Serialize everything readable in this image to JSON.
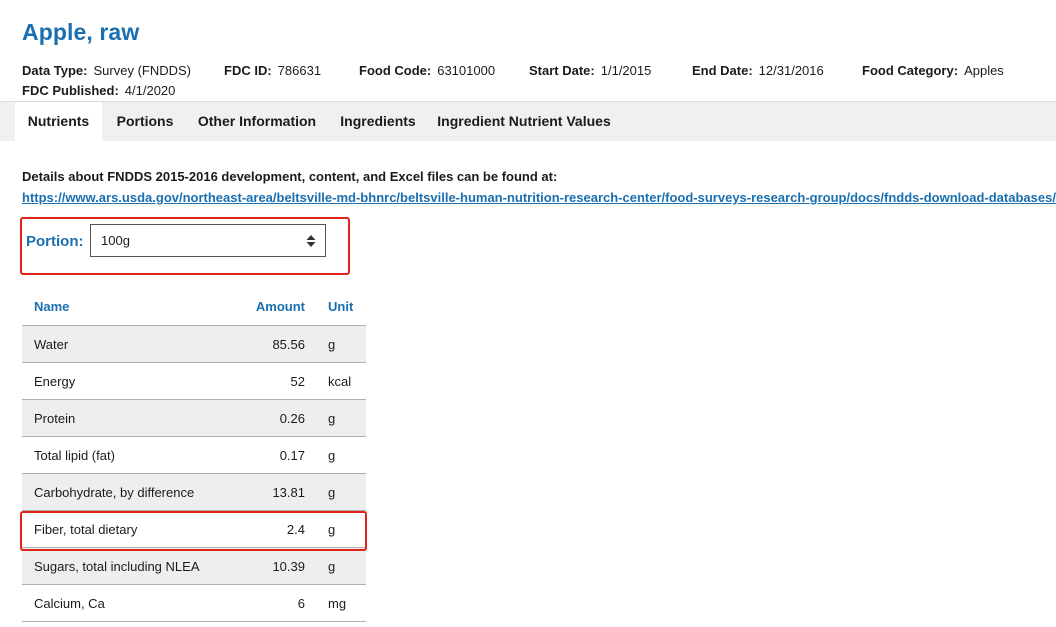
{
  "title": "Apple, raw",
  "meta": {
    "data_type": {
      "label": "Data Type:",
      "value": "Survey (FNDDS)"
    },
    "fdc_id": {
      "label": "FDC ID:",
      "value": "786631"
    },
    "food_code": {
      "label": "Food Code:",
      "value": "63101000"
    },
    "start_date": {
      "label": "Start Date:",
      "value": "1/1/2015"
    },
    "end_date": {
      "label": "End Date:",
      "value": "12/31/2016"
    },
    "food_category": {
      "label": "Food Category:",
      "value": "Apples"
    },
    "fdc_published": {
      "label": "FDC Published:",
      "value": "4/1/2020"
    }
  },
  "tabs": [
    {
      "label": "Nutrients",
      "active": true
    },
    {
      "label": "Portions",
      "active": false
    },
    {
      "label": "Other Information",
      "active": false
    },
    {
      "label": "Ingredients",
      "active": false
    },
    {
      "label": "Ingredient Nutrient Values",
      "active": false
    }
  ],
  "details": {
    "text": "Details about FNDDS 2015-2016 development, content, and Excel files can be found at:",
    "link": "https://www.ars.usda.gov/northeast-area/beltsville-md-bhnrc/beltsville-human-nutrition-research-center/food-surveys-research-group/docs/fndds-download-databases/"
  },
  "portion": {
    "label": "Portion:",
    "selected": "100g",
    "icon": "sort-arrows-icon"
  },
  "table": {
    "headers": {
      "name": "Name",
      "amount": "Amount",
      "unit": "Unit"
    },
    "rows": [
      {
        "name": "Water",
        "amount": "85.56",
        "unit": "g"
      },
      {
        "name": "Energy",
        "amount": "52",
        "unit": "kcal"
      },
      {
        "name": "Protein",
        "amount": "0.26",
        "unit": "g"
      },
      {
        "name": "Total lipid (fat)",
        "amount": "0.17",
        "unit": "g"
      },
      {
        "name": "Carbohydrate, by difference",
        "amount": "13.81",
        "unit": "g"
      },
      {
        "name": "Fiber, total dietary",
        "amount": "2.4",
        "unit": "g"
      },
      {
        "name": "Sugars, total including NLEA",
        "amount": "10.39",
        "unit": "g"
      },
      {
        "name": "Calcium, Ca",
        "amount": "6",
        "unit": "mg"
      }
    ]
  },
  "colors": {
    "accent": "#1a6fb0",
    "highlight": "#e2231a",
    "tab_bar": "#f0f0f0",
    "row_alt": "#eeeeee"
  }
}
